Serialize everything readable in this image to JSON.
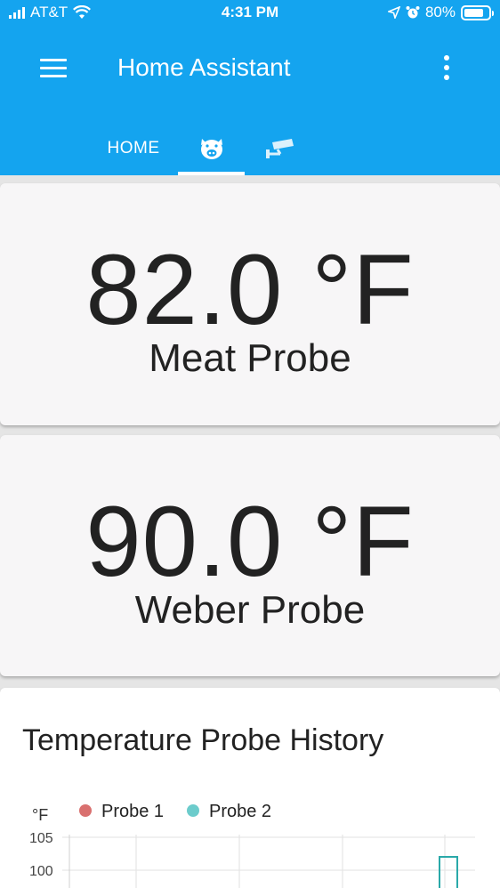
{
  "status_bar": {
    "carrier": "AT&T",
    "time": "4:31 PM",
    "battery": "80%",
    "battery_level": 0.8
  },
  "header": {
    "title": "Home Assistant",
    "menu_icon": "hamburger-menu-icon",
    "overflow_icon": "more-vertical-icon"
  },
  "tabs": [
    {
      "label": "HOME"
    },
    {
      "icon": "pig-icon",
      "active": true
    },
    {
      "icon": "cctv-camera-icon"
    }
  ],
  "sensors": [
    {
      "value": "82.0 °F",
      "name": "Meat Probe"
    },
    {
      "value": "90.0 °F",
      "name": "Weber Probe"
    }
  ],
  "history": {
    "title": "Temperature Probe History",
    "unit": "°F",
    "legend": [
      {
        "name": "Probe 1",
        "color": "#d9706f"
      },
      {
        "name": "Probe 2",
        "color": "#6ccccc"
      }
    ],
    "y_ticks": [
      "105",
      "100"
    ]
  },
  "chart_data": {
    "type": "line",
    "ylabel": "°F",
    "series": [
      {
        "name": "Probe 1"
      },
      {
        "name": "Probe 2"
      }
    ],
    "ylim_visible": [
      100,
      105
    ],
    "grid": true,
    "legend": "top-left"
  },
  "colors": {
    "primary": "#14a4ef",
    "probe1": "#d9706f",
    "probe2": "#6ccccc"
  }
}
